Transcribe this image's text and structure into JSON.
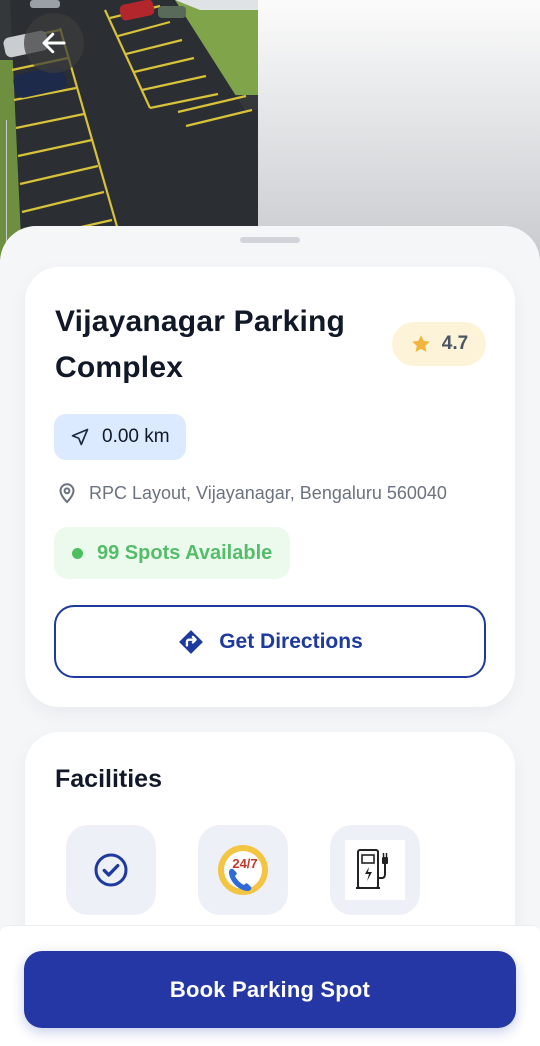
{
  "parking": {
    "name": "Vijayanagar Parking Complex",
    "rating": "4.7",
    "distance": "0.00 km",
    "address": "RPC Layout, Vijayanagar, Bengaluru 560040",
    "availability": "99 Spots Available"
  },
  "actions": {
    "directions_label": "Get Directions",
    "book_label": "Book Parking Spot"
  },
  "facilities": {
    "title": "Facilities",
    "items": [
      {
        "icon": "check-circle-icon"
      },
      {
        "icon": "support-24-7-icon"
      },
      {
        "icon": "ev-charging-icon"
      }
    ]
  },
  "icons": {
    "back": "arrow-left-icon",
    "rating": "star-icon",
    "distance": "navigation-arrow-icon",
    "address": "map-pin-icon",
    "directions": "directions-turn-icon"
  },
  "colors": {
    "primary": "#2537a5",
    "outline": "#1e3a9e",
    "available_green": "#55bd6a",
    "rating_bg": "#fdf3d8",
    "star": "#f2b43b",
    "distance_bg": "#dbeafe"
  }
}
